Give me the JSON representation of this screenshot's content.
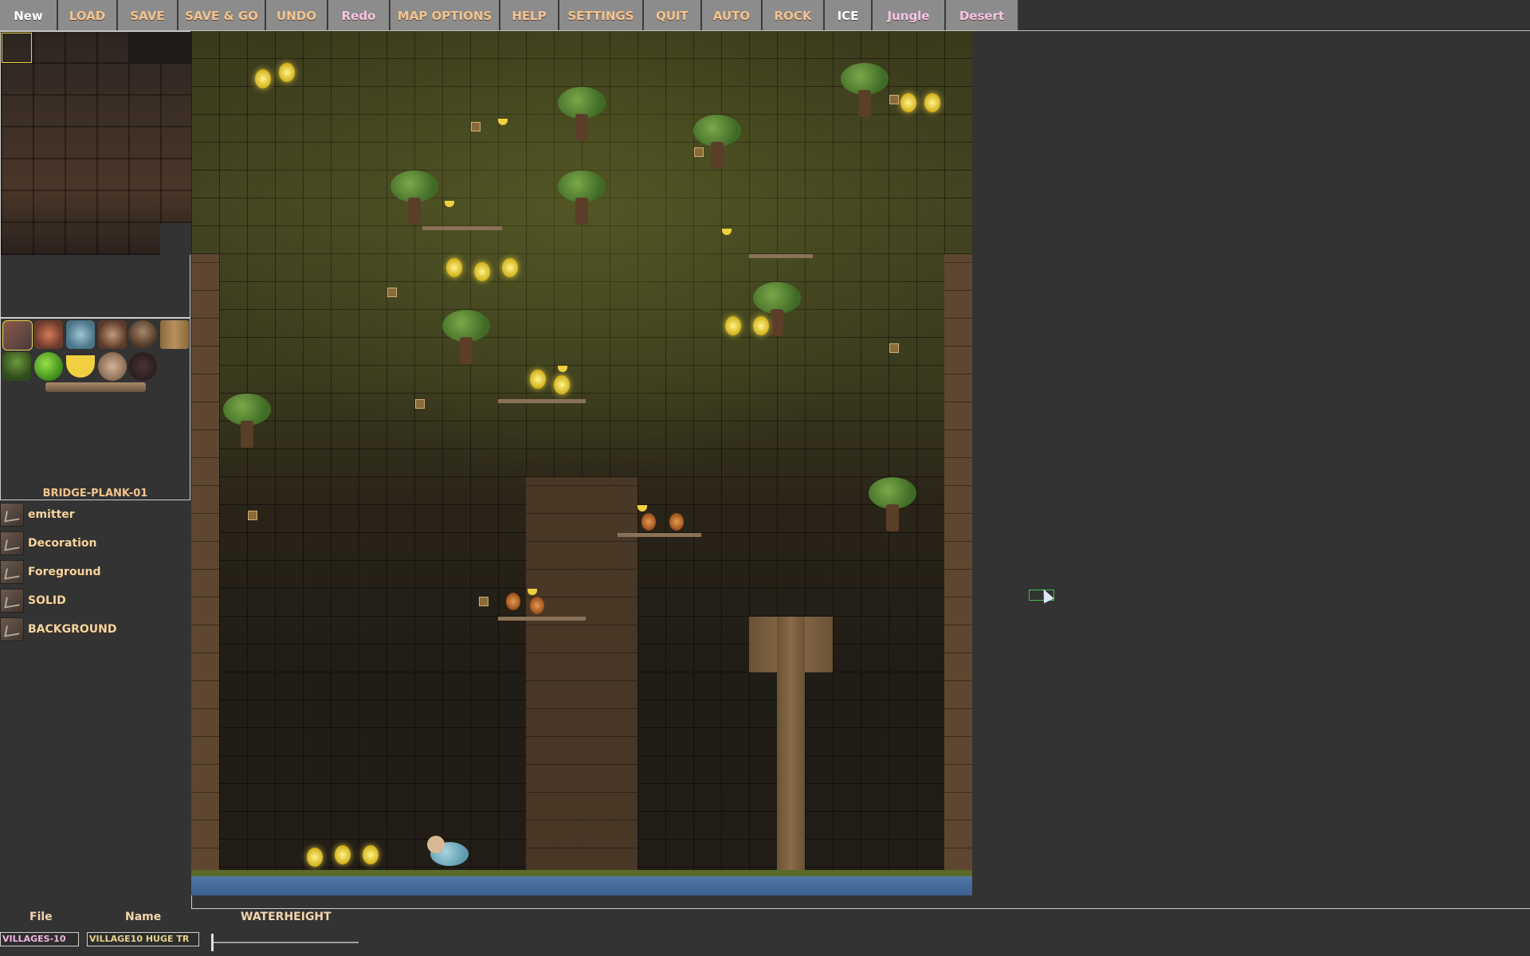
{
  "toolbar": {
    "buttons": [
      {
        "label": "New",
        "id": "new"
      },
      {
        "label": "LOAD",
        "id": "load"
      },
      {
        "label": "SAVE",
        "id": "save"
      },
      {
        "label": "SAVE & GO",
        "id": "save-go"
      },
      {
        "label": "UNDO",
        "id": "undo"
      },
      {
        "label": "Redo",
        "id": "redo"
      },
      {
        "label": "MAP OPTIONS",
        "id": "map-options"
      },
      {
        "label": "HELP",
        "id": "help"
      },
      {
        "label": "SETTINGS",
        "id": "settings"
      },
      {
        "label": "QUIT",
        "id": "quit"
      },
      {
        "label": "AUTO",
        "id": "auto"
      },
      {
        "label": "ROCK",
        "id": "rock"
      },
      {
        "label": "ICE",
        "id": "ice"
      },
      {
        "label": "Jungle",
        "id": "jungle"
      },
      {
        "label": "Desert",
        "id": "desert"
      }
    ]
  },
  "palette": {
    "selected_object_name": "BRIDGE-PLANK-01",
    "objects": [
      "volcano-rock",
      "bird",
      "dragon-fish",
      "villager",
      "blob-monster",
      "crate",
      "tree",
      "apple",
      "banana",
      "coconut",
      "dark-orb",
      "bridge-plank"
    ]
  },
  "layers": [
    {
      "label": "emitter"
    },
    {
      "label": "Decoration"
    },
    {
      "label": "Foreground"
    },
    {
      "label": "SOLID"
    },
    {
      "label": "BACKGROUND"
    }
  ],
  "bottom": {
    "file_label": "File",
    "name_label": "Name",
    "waterheight_label": "WATERHEIGHT",
    "file_value": "VILLAGES-10",
    "name_value": "VILLAGE10 HUGE TR",
    "waterheight": 0.0
  },
  "colors": {
    "background": "#333333",
    "toolbar_button": "#8c8c8c",
    "label_accent": "#f3c48f",
    "selection": "#e4d44a",
    "cursor_box": "#3cc44c"
  }
}
